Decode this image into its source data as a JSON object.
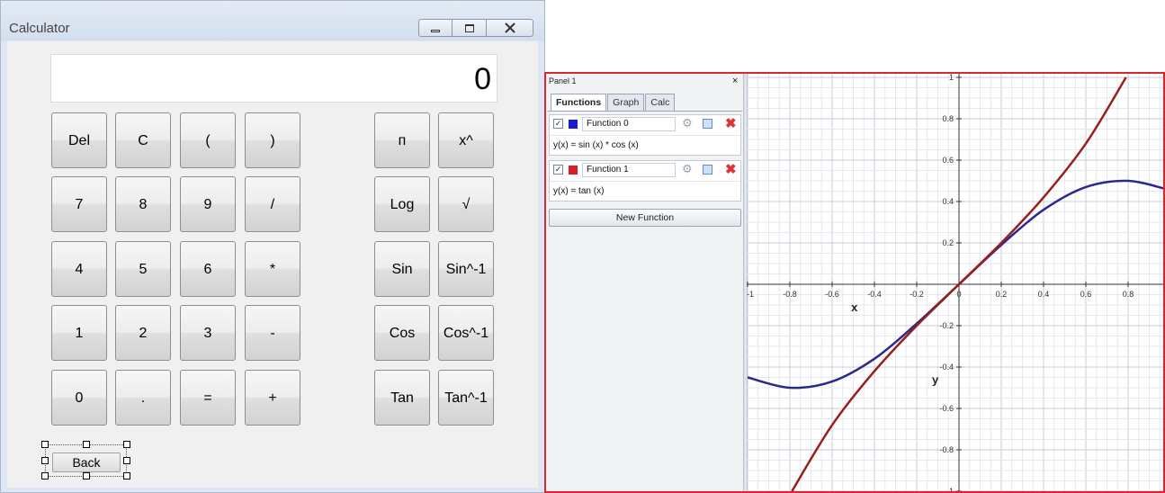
{
  "calculator": {
    "title": "Calculator",
    "display": "0",
    "keys": [
      {
        "name": "del-key",
        "label": "Del"
      },
      {
        "name": "clear-key",
        "label": "C"
      },
      {
        "name": "open-paren-key",
        "label": "("
      },
      {
        "name": "close-paren-key",
        "label": ")"
      },
      {
        "name": "pi-key",
        "label": "п"
      },
      {
        "name": "power-key",
        "label": "x^"
      },
      {
        "name": "seven-key",
        "label": "7"
      },
      {
        "name": "eight-key",
        "label": "8"
      },
      {
        "name": "nine-key",
        "label": "9"
      },
      {
        "name": "divide-key",
        "label": "/"
      },
      {
        "name": "log-key",
        "label": "Log"
      },
      {
        "name": "sqrt-key",
        "label": "√"
      },
      {
        "name": "four-key",
        "label": "4"
      },
      {
        "name": "five-key",
        "label": "5"
      },
      {
        "name": "six-key",
        "label": "6"
      },
      {
        "name": "multiply-key",
        "label": "*"
      },
      {
        "name": "sin-key",
        "label": "Sin"
      },
      {
        "name": "arcsin-key",
        "label": "Sin^-1"
      },
      {
        "name": "one-key",
        "label": "1"
      },
      {
        "name": "two-key",
        "label": "2"
      },
      {
        "name": "three-key",
        "label": "3"
      },
      {
        "name": "minus-key",
        "label": "-"
      },
      {
        "name": "cos-key",
        "label": "Cos"
      },
      {
        "name": "arccos-key",
        "label": "Cos^-1"
      },
      {
        "name": "zero-key",
        "label": "0"
      },
      {
        "name": "decimal-key",
        "label": "."
      },
      {
        "name": "equals-key",
        "label": "="
      },
      {
        "name": "plus-key",
        "label": "+"
      },
      {
        "name": "tan-key",
        "label": "Tan"
      },
      {
        "name": "arctan-key",
        "label": "Tan^-1"
      }
    ],
    "back_label": "Back"
  },
  "graph_panel": {
    "title": "Panel 1",
    "close_glyph": "×",
    "tabs": [
      "Functions",
      "Graph",
      "Calc"
    ],
    "active_tab": "Functions",
    "functions": [
      {
        "name": "Function 0",
        "color": "#1a1ad6",
        "expression": "y(x) = sin (x) * cos (x)",
        "checked": true
      },
      {
        "name": "Function 1",
        "color": "#d42020",
        "expression": "y(x) = tan (x)",
        "checked": true
      }
    ],
    "new_function_label": "New Function"
  },
  "chart_data": {
    "type": "line",
    "xlabel": "x",
    "ylabel": "y",
    "xlim": [
      -1.0,
      0.98
    ],
    "ylim": [
      -1.0,
      1.0
    ],
    "x_ticks": [
      "-1",
      "-0.8",
      "-0.6",
      "-0.4",
      "-0.2",
      "0",
      "0.2",
      "0.4",
      "0.6",
      "0.8"
    ],
    "y_ticks": [
      "-1",
      "-0.8",
      "-0.6",
      "-0.4",
      "-0.2",
      "0.2",
      "0.4",
      "0.6",
      "0.8",
      "1"
    ],
    "grid": true,
    "series": [
      {
        "name": "Function 0",
        "color": "#2a2a8c",
        "x": [
          -1.0,
          -0.8,
          -0.6,
          -0.4,
          -0.2,
          0,
          0.2,
          0.4,
          0.6,
          0.8,
          0.98
        ],
        "y": [
          -0.45,
          -0.5,
          -0.47,
          -0.36,
          -0.19,
          0,
          0.19,
          0.36,
          0.47,
          0.5,
          0.46
        ]
      },
      {
        "name": "Function 1",
        "color": "#9a1e1e",
        "x": [
          -0.79,
          -0.6,
          -0.4,
          -0.2,
          0,
          0.2,
          0.4,
          0.6,
          0.79
        ],
        "y": [
          -1.0,
          -0.68,
          -0.42,
          -0.2,
          0,
          0.2,
          0.42,
          0.68,
          1.0
        ]
      }
    ]
  }
}
